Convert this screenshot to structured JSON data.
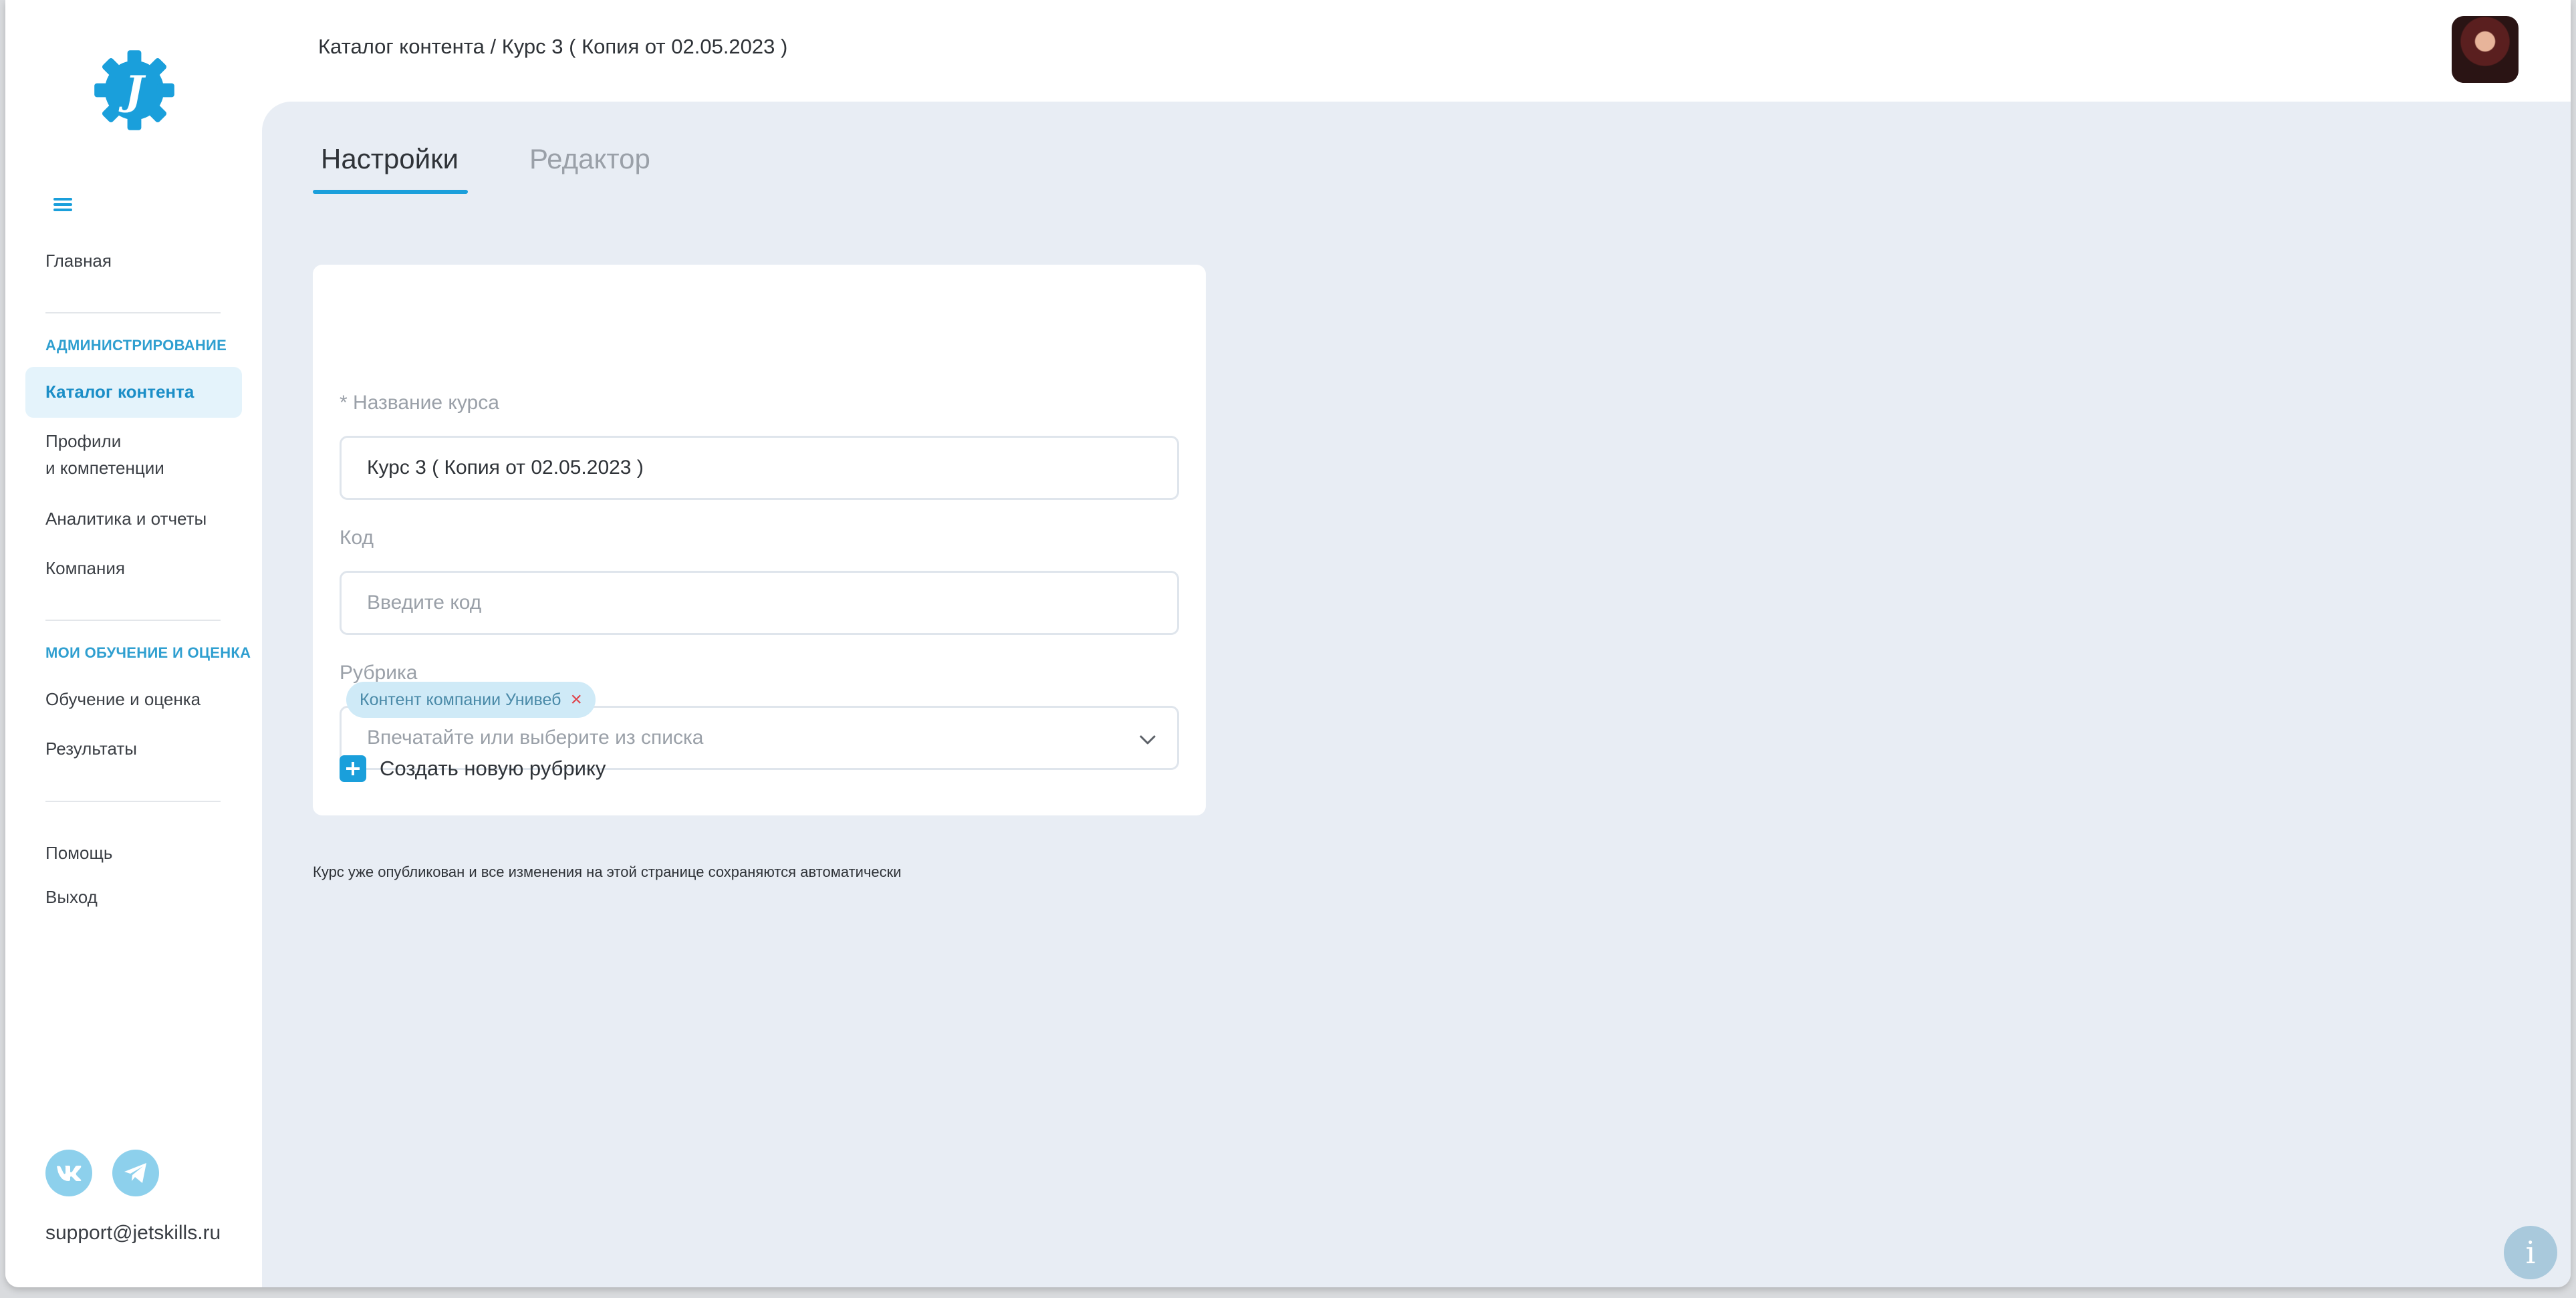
{
  "header": {
    "breadcrumb": "Каталог контента / Курс 3 ( Копия от 02.05.2023 )"
  },
  "tabs": [
    {
      "label": "Настройки",
      "active": true
    },
    {
      "label": "Редактор",
      "active": false
    }
  ],
  "sidebar": {
    "logo_letter": "J",
    "items": {
      "home": "Главная",
      "section_admin": "АДМИНИСТРИРОВАНИЕ",
      "catalog": "Каталог контента",
      "profiles_line1": "Профили",
      "profiles_line2": "и компетенции",
      "analytics": "Аналитика и отчеты",
      "company": "Компания",
      "section_my": "МОИ ОБУЧЕНИЕ И ОЦЕНКА",
      "learning": "Обучение и оценка",
      "results": "Результаты",
      "help": "Помощь",
      "logout": "Выход"
    },
    "support_email": "support@jetskills.ru"
  },
  "form": {
    "name_label_required": "*",
    "name_label": "Название курса",
    "name_value": "Курс 3 ( Копия от 02.05.2023 )",
    "code_label": "Код",
    "code_placeholder": "Введите код",
    "rubric_label": "Рубрика",
    "rubric_placeholder": "Впечатайте или выберите из списка",
    "rubric_chips": [
      "Контент компании Унивеб"
    ],
    "create_rubric": "Создать новую рубрику"
  },
  "autosave_note": "Курс уже опубликован и все изменения на этой странице сохраняются автоматически",
  "info_glyph": "i",
  "colors": {
    "accent": "#1a9fdb",
    "background": "#e8edf4",
    "chip_bg": "#cfeaf7",
    "remove": "#e0434a"
  }
}
